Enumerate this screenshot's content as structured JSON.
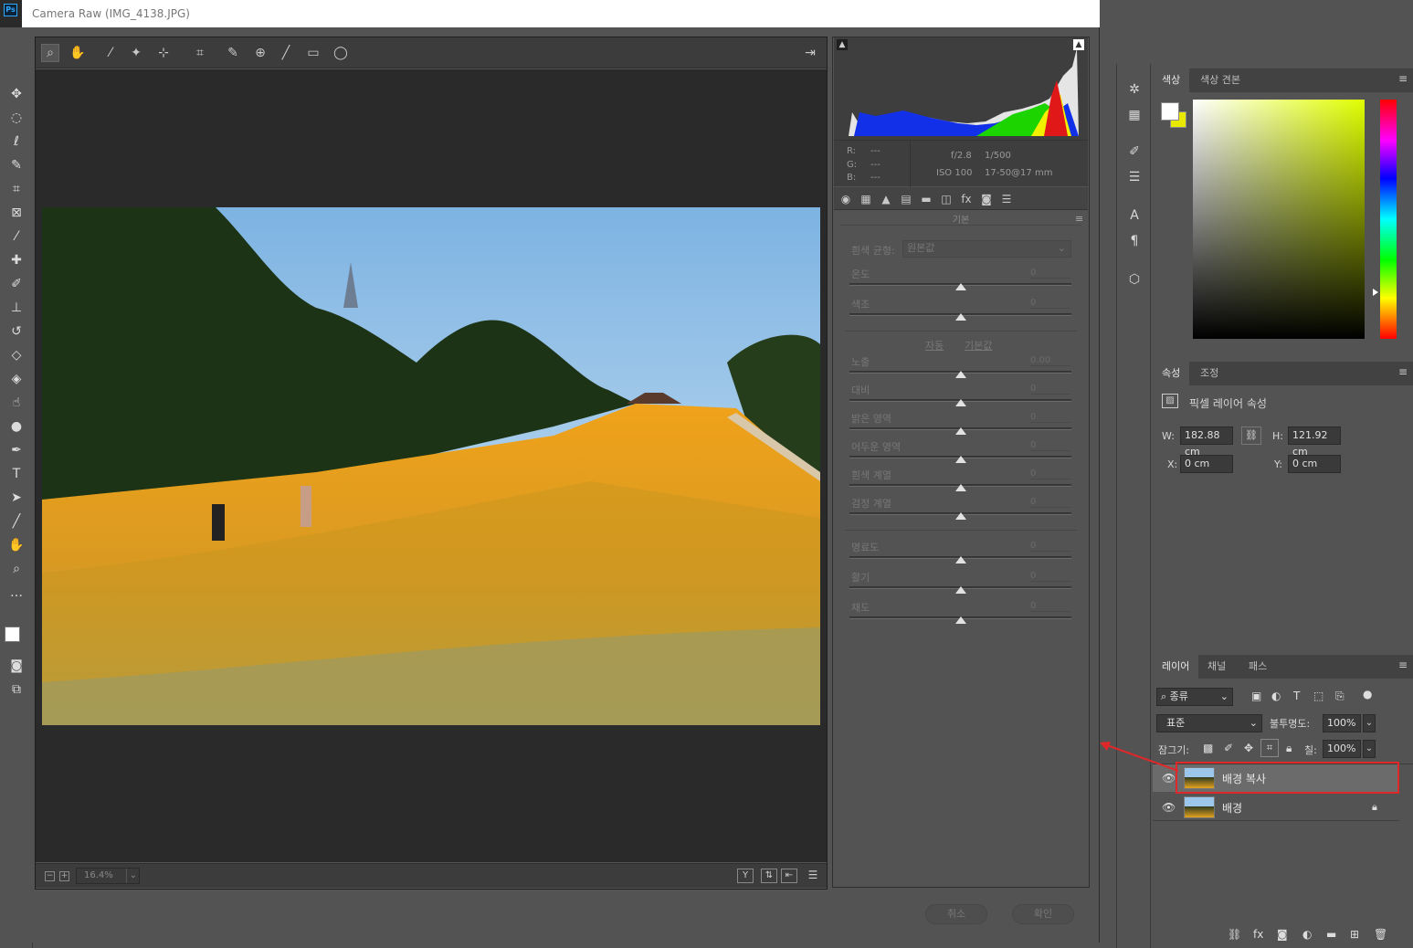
{
  "window": {
    "title": "Camera Raw (IMG_4138.JPG)",
    "app_logo": "Ps"
  },
  "photo_info": {
    "rgb": [
      {
        "label": "R:",
        "value": "---"
      },
      {
        "label": "G:",
        "value": "---"
      },
      {
        "label": "B:",
        "value": "---"
      }
    ],
    "aperture": "f/2.8",
    "shutter": "1/500",
    "iso": "ISO 100",
    "lens": "17-50@17 mm"
  },
  "basic_panel": {
    "title": "기본",
    "wb_label": "흰색 균형:",
    "wb_value": "원본값",
    "auto_link": "자동",
    "default_link": "기본값",
    "sliders_wb": [
      {
        "label": "온도",
        "value": "0",
        "position": 0.5
      },
      {
        "label": "색조",
        "value": "0",
        "position": 0.5
      }
    ],
    "sliders_tone": [
      {
        "label": "노출",
        "value": "0.00",
        "position": 0.5
      },
      {
        "label": "대비",
        "value": "0",
        "position": 0.5
      },
      {
        "label": "밝은 영역",
        "value": "0",
        "position": 0.5
      },
      {
        "label": "어두운 영역",
        "value": "0",
        "position": 0.5
      },
      {
        "label": "흰색 계열",
        "value": "0",
        "position": 0.5
      },
      {
        "label": "검정 계열",
        "value": "0",
        "position": 0.5
      }
    ],
    "sliders_presence": [
      {
        "label": "명료도",
        "value": "0",
        "position": 0.5
      },
      {
        "label": "활기",
        "value": "0",
        "position": 0.5
      },
      {
        "label": "채도",
        "value": "0",
        "position": 0.5
      }
    ]
  },
  "status": {
    "zoom": "16.4%"
  },
  "dialog_buttons": {
    "cancel": "취소",
    "ok": "확인"
  },
  "color_panel": {
    "tabs": [
      "색상",
      "색상 견본"
    ],
    "fg_color": "#ffffff",
    "bg_color": "#e8e800"
  },
  "properties_panel": {
    "tabs": [
      "속성",
      "조정"
    ],
    "heading": "픽셀 레이어 속성",
    "w_label": "W:",
    "w_value": "182.88 cm",
    "h_label": "H:",
    "h_value": "121.92 cm",
    "x_label": "X:",
    "x_value": "0 cm",
    "y_label": "Y:",
    "y_value": "0 cm"
  },
  "layers_panel": {
    "tabs": [
      "레이어",
      "채널",
      "패스"
    ],
    "filter_kind": "종류",
    "blend_mode": "표준",
    "opacity_label": "불투명도:",
    "opacity_value": "100%",
    "lock_label": "잠그기:",
    "fill_label": "칠:",
    "fill_value": "100%",
    "layers": [
      {
        "name": "배경 복사",
        "selected": true,
        "locked": false
      },
      {
        "name": "배경",
        "selected": false,
        "locked": true
      }
    ]
  },
  "accent": {
    "highlight_border": "#e0282a",
    "arrow": "#e0282a"
  }
}
